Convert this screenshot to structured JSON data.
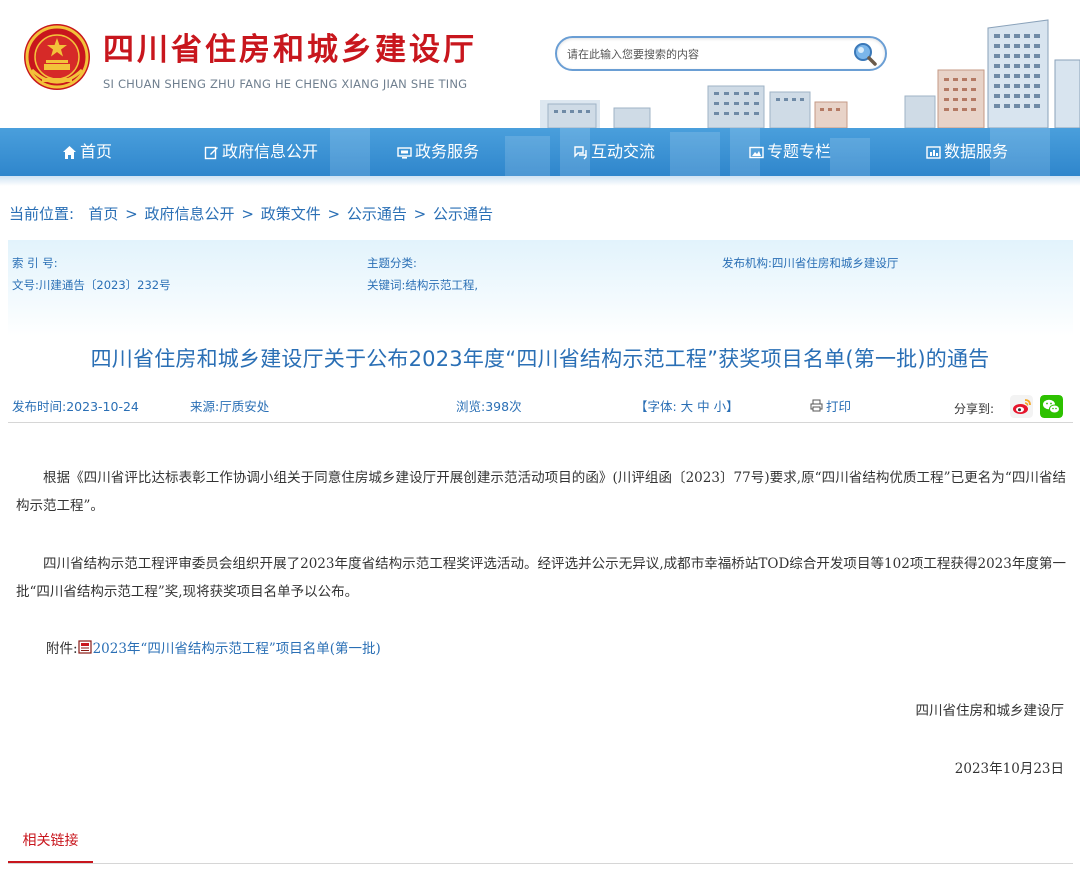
{
  "header": {
    "title": "四川省住房和城乡建设厅",
    "subtitle": "SI CHUAN SHENG ZHU FANG HE CHENG XIANG JIAN SHE TING",
    "emblem_icon": "national-emblem-icon",
    "search_placeholder": "请在此输入您要搜索的内容",
    "search_icon": "magnifier-icon"
  },
  "nav": {
    "items": [
      {
        "label": "首页",
        "icon": "home-icon"
      },
      {
        "label": "政府信息公开",
        "icon": "edit-icon"
      },
      {
        "label": "政务服务",
        "icon": "monitor-icon"
      },
      {
        "label": "互动交流",
        "icon": "interaction-icon"
      },
      {
        "label": "专题专栏",
        "icon": "picture-icon"
      },
      {
        "label": "数据服务",
        "icon": "data-icon"
      }
    ]
  },
  "breadcrumb": {
    "label": "当前位置:",
    "items": [
      "首页",
      "政府信息公开",
      "政策文件",
      "公示通告",
      "公示通告"
    ],
    "separator": ">"
  },
  "meta": {
    "index_no": "索 引 号:",
    "doc_no": "文号:川建通告〔2023〕232号",
    "topic": "主题分类:",
    "keywords": "关键词:结构示范工程,",
    "publisher": "发布机构:四川省住房和城乡建设厅"
  },
  "doc": {
    "title": "四川省住房和城乡建设厅关于公布2023年度“四川省结构示范工程”获奖项目名单(第一批)的通告"
  },
  "info": {
    "publish_time": "发布时间:2023-10-24",
    "source": "来源:厅质安处",
    "views": "浏览:398次",
    "font_size": "【字体: 大 中 小】",
    "print": "打印",
    "share_label": "分享到:",
    "share_icons": [
      "weibo-icon",
      "wechat-icon"
    ],
    "colors": {
      "weibo": "#f5a623",
      "wechat": "#2dc100"
    }
  },
  "content": {
    "para1": "根据《四川省评比达标表彰工作协调小组关于同意住房城乡建设厅开展创建示范活动项目的函》(川评组函〔2023〕77号)要求,原“四川省结构优质工程”已更名为“四川省结构示范工程”。",
    "para2": "四川省结构示范工程评审委员会组织开展了2023年度省结构示范工程奖评选活动。经评选并公示无异议,成都市幸福桥站TOD综合开发项目等102项工程获得2023年度第一批“四川省结构示范工程”奖,现将获奖项目名单予以公布。",
    "attach_label": "附件:",
    "attach_icon": "pdf-file-icon",
    "attach_link": "2023年“四川省结构示范工程”项目名单(第一批)",
    "sign_org": "四川省住房和城乡建设厅",
    "sign_date": "2023年10月23日"
  },
  "related": {
    "tab_label": "相关链接"
  },
  "theme": {
    "brand_red": "#c8161d",
    "link_blue": "#2a6fb5",
    "nav_blue": "#3a8fd4"
  }
}
